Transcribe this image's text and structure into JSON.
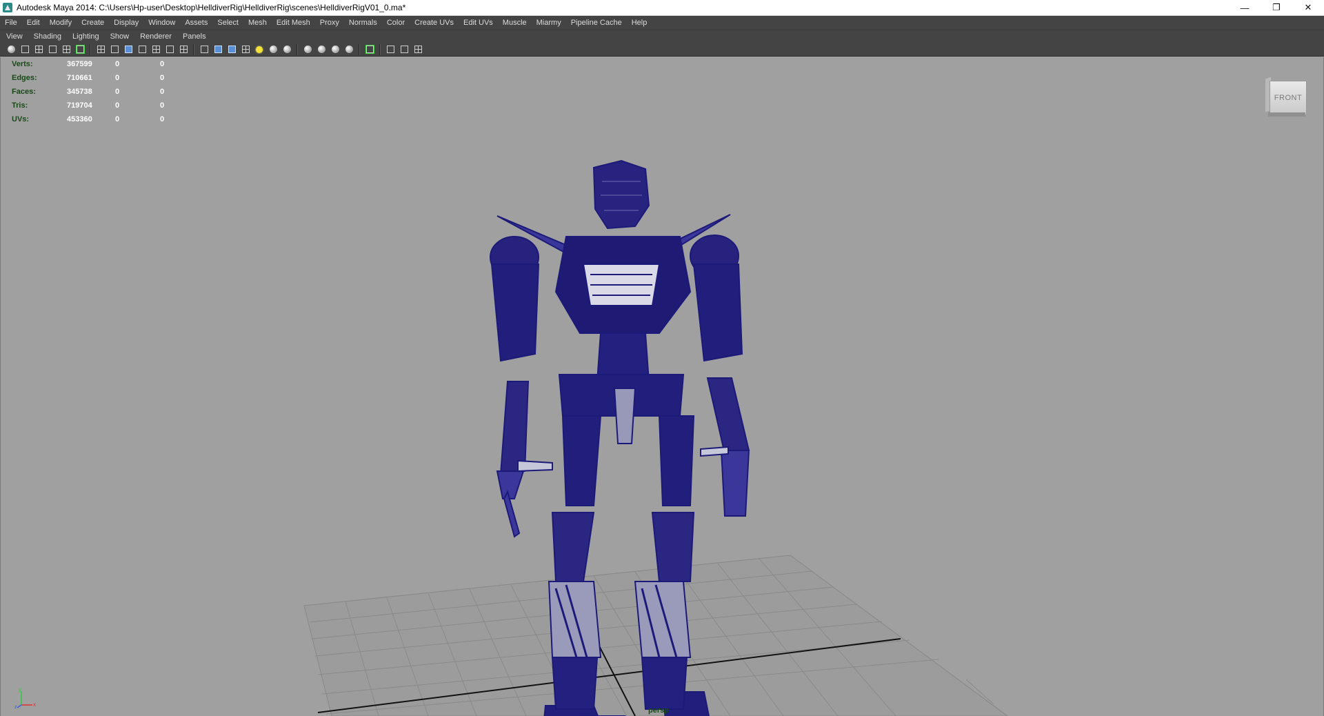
{
  "window": {
    "title": "Autodesk Maya 2014: C:\\Users\\Hp-user\\Desktop\\HelldiverRig\\HelldiverRig\\scenes\\HelldiverRigV01_0.ma*",
    "minimize": "—",
    "maximize": "❐",
    "close": "✕"
  },
  "menubar": [
    "File",
    "Edit",
    "Modify",
    "Create",
    "Display",
    "Window",
    "Assets",
    "Select",
    "Mesh",
    "Edit Mesh",
    "Proxy",
    "Normals",
    "Color",
    "Create UVs",
    "Edit UVs",
    "Muscle",
    "Miarmy",
    "Pipeline Cache",
    "Help"
  ],
  "panel_menu": [
    "View",
    "Shading",
    "Lighting",
    "Show",
    "Renderer",
    "Panels"
  ],
  "toolbar_icons": [
    "camera-select-icon",
    "camera-attributes-icon",
    "bookmarks-icon",
    "image-plane-icon",
    "grid-toggle-icon",
    "isolate-select-icon",
    "wireframe-icon",
    "smooth-shade-icon",
    "default-material-icon",
    "textured-icon",
    "use-all-lights-icon",
    "shadows-icon",
    "xray-icon",
    "xray-joints-icon",
    "backface-culling-icon",
    "resolution-gate-icon",
    "film-gate-icon",
    "gate-mask-icon"
  ],
  "hud": {
    "rows": [
      {
        "label": "Verts:",
        "a": "367599",
        "b": "0",
        "c": "0"
      },
      {
        "label": "Edges:",
        "a": "710661",
        "b": "0",
        "c": "0"
      },
      {
        "label": "Faces:",
        "a": "345738",
        "b": "0",
        "c": "0"
      },
      {
        "label": "Tris:",
        "a": "719704",
        "b": "0",
        "c": "0"
      },
      {
        "label": "UVs:",
        "a": "453360",
        "b": "0",
        "c": "0"
      }
    ]
  },
  "viewcube": {
    "face_label": "FRONT"
  },
  "camera_label": "persp",
  "axis": {
    "y": "y",
    "x": "x",
    "z": "z"
  },
  "colors": {
    "wireframe": "#1c1a78",
    "viewport_bg": "#a0a0a0",
    "hud_label": "#174a17",
    "ui_dark": "#444444"
  }
}
